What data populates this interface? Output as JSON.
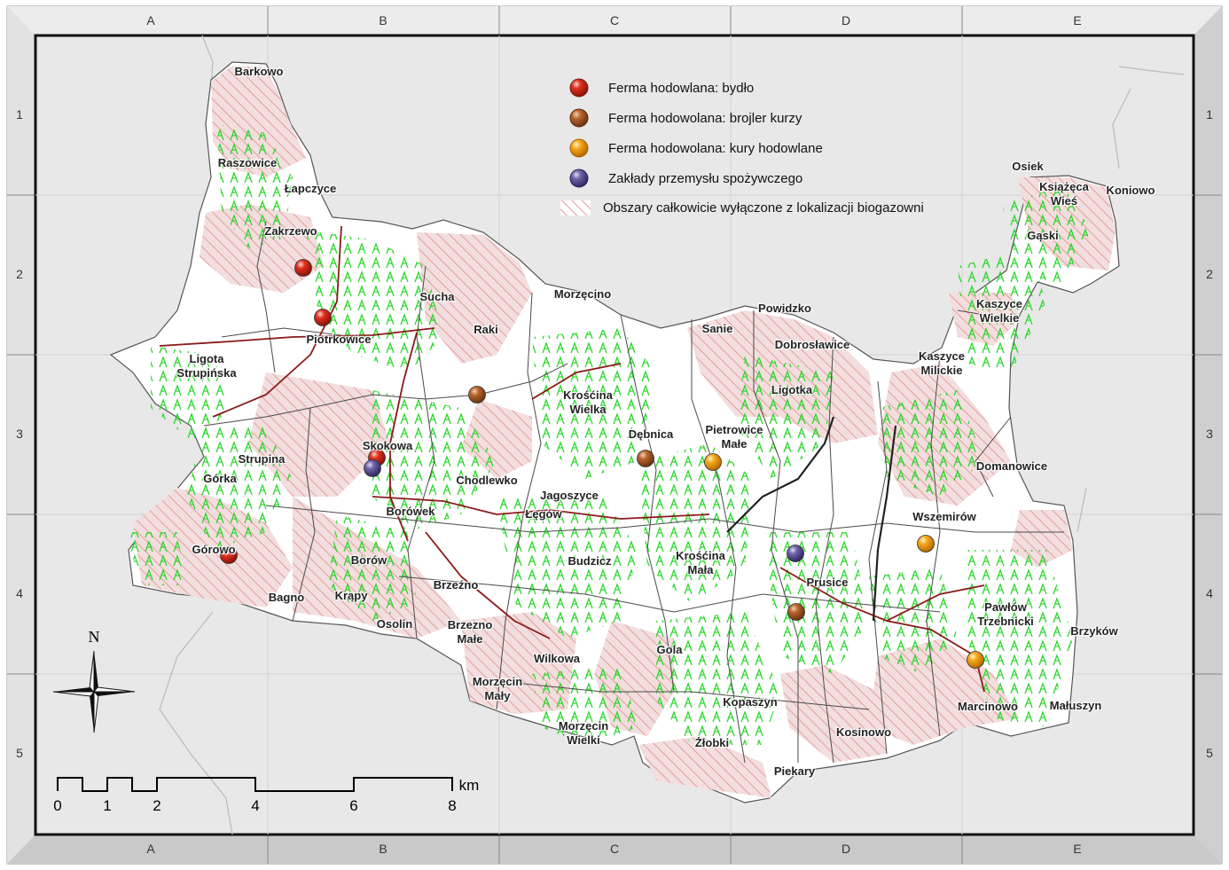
{
  "grid": {
    "columns": [
      "A",
      "B",
      "C",
      "D",
      "E"
    ],
    "rows": [
      "1",
      "2",
      "3",
      "4",
      "5"
    ]
  },
  "legend": {
    "items": [
      {
        "label": "Ferma hodowlana: bydło",
        "color": "#d8231c",
        "icon": "cattle-farm-marker"
      },
      {
        "label": "Ferma hodowolana: brojler kurzy",
        "color": "#b5602a",
        "icon": "broiler-farm-marker"
      },
      {
        "label": "Ferma hodowolana: kury hodowlane",
        "color": "#f0a41c",
        "icon": "laying-hen-farm-marker"
      },
      {
        "label": "Zakłady przemysłu spożywczego",
        "color": "#6e63a8",
        "icon": "food-industry-marker"
      },
      {
        "label": "Obszary całkowicie wyłączone z lokalizacji biogazowni",
        "color": "#e8a0a0",
        "icon": "excluded-area-hatch"
      }
    ]
  },
  "places": [
    {
      "name": "Barkowo"
    },
    {
      "name": "Raszowice"
    },
    {
      "name": "Łapczyce"
    },
    {
      "name": "Zakrzewo"
    },
    {
      "name": "Sucha"
    },
    {
      "name": "Morzęcino"
    },
    {
      "name": "Raki"
    },
    {
      "name": "Piotrkowice"
    },
    {
      "name": "Ligota\nStrupińska"
    },
    {
      "name": "Powidzko"
    },
    {
      "name": "Sanie"
    },
    {
      "name": "Dobrosławice"
    },
    {
      "name": "Kaszyce\nWielkie"
    },
    {
      "name": "Kaszyce\nMilickie"
    },
    {
      "name": "Ligotka"
    },
    {
      "name": "Krośćina\nWielka"
    },
    {
      "name": "Dębnica"
    },
    {
      "name": "Pietrowice\nMałe"
    },
    {
      "name": "Skokowa"
    },
    {
      "name": "Strupina"
    },
    {
      "name": "Górka"
    },
    {
      "name": "Chodlewko"
    },
    {
      "name": "Jagoszyce"
    },
    {
      "name": "Łęgów"
    },
    {
      "name": "Domanowice"
    },
    {
      "name": "Borówek"
    },
    {
      "name": "Wszemirów"
    },
    {
      "name": "Górowo"
    },
    {
      "name": "Borów"
    },
    {
      "name": "Budzicz"
    },
    {
      "name": "Krośćina\nMała"
    },
    {
      "name": "Brzeźno"
    },
    {
      "name": "Prusice"
    },
    {
      "name": "Bagno"
    },
    {
      "name": "Krąpy"
    },
    {
      "name": "Osolin"
    },
    {
      "name": "Brzezno\nMałe"
    },
    {
      "name": "Pawłów\nTrzebnicki"
    },
    {
      "name": "Brzyków"
    },
    {
      "name": "Gola"
    },
    {
      "name": "Wilkowa"
    },
    {
      "name": "Morzęcin\nMały"
    },
    {
      "name": "Kopaszyn"
    },
    {
      "name": "Marcinowo"
    },
    {
      "name": "Małuszyn"
    },
    {
      "name": "Morzęcin\nWielki"
    },
    {
      "name": "Żłobki"
    },
    {
      "name": "Kosinowo"
    },
    {
      "name": "Piekary"
    },
    {
      "name": "Osiek"
    },
    {
      "name": "Książęca\nWieś"
    },
    {
      "name": "Koniowo"
    },
    {
      "name": "Gąski"
    }
  ],
  "facilities": [
    {
      "type": "cattle",
      "color": "#d8231c"
    },
    {
      "type": "cattle",
      "color": "#d8231c"
    },
    {
      "type": "cattle",
      "color": "#d8231c"
    },
    {
      "type": "food-industry",
      "color": "#6e63a8"
    },
    {
      "type": "broiler",
      "color": "#b5602a"
    },
    {
      "type": "broiler",
      "color": "#b5602a"
    },
    {
      "type": "broiler",
      "color": "#b5602a"
    },
    {
      "type": "laying-hens",
      "color": "#f0a41c"
    },
    {
      "type": "laying-hens",
      "color": "#f0a41c"
    },
    {
      "type": "laying-hens",
      "color": "#f0a41c"
    },
    {
      "type": "food-industry",
      "color": "#6e63a8"
    },
    {
      "type": "cattle",
      "color": "#d8231c"
    }
  ],
  "north_arrow": {
    "label": "N"
  },
  "scale_bar": {
    "ticks": [
      "0",
      "1",
      "2",
      "4",
      "6",
      "8"
    ],
    "unit": "km"
  },
  "colors": {
    "background": "#e6e6e6",
    "municipality_fill": "#ffffff",
    "exclusion_fill": "#f1dcdc",
    "forest": "#22dd22",
    "roads": "#8b1a1a",
    "frame_bevel": "#d9d9d9"
  }
}
